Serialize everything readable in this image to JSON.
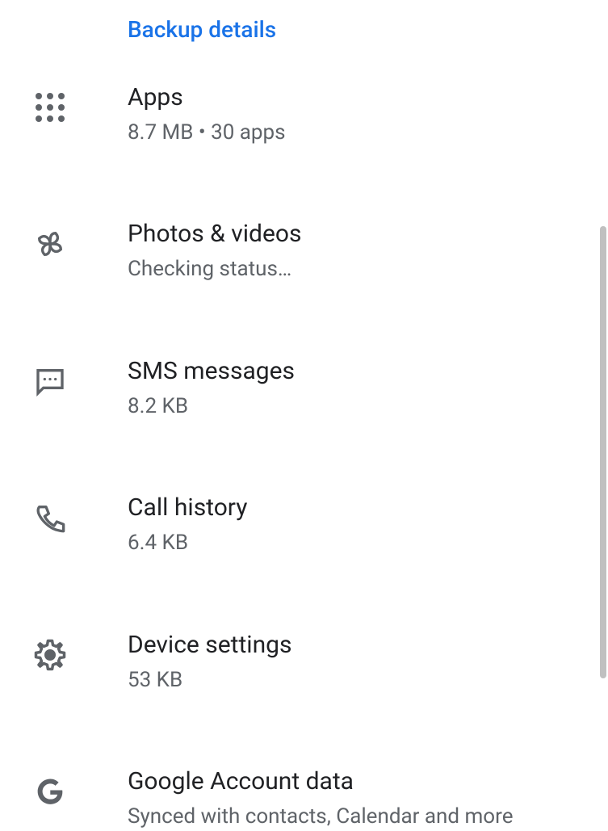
{
  "header": {
    "title": "Backup details"
  },
  "items": [
    {
      "title": "Apps",
      "subtitle": "8.7 MB • 30 apps"
    },
    {
      "title": "Photos & videos",
      "subtitle": "Checking status…"
    },
    {
      "title": "SMS messages",
      "subtitle": "8.2 KB"
    },
    {
      "title": "Call history",
      "subtitle": "6.4 KB"
    },
    {
      "title": "Device settings",
      "subtitle": "53 KB"
    },
    {
      "title": "Google Account data",
      "subtitle": "Synced with contacts, Calendar and more"
    }
  ]
}
